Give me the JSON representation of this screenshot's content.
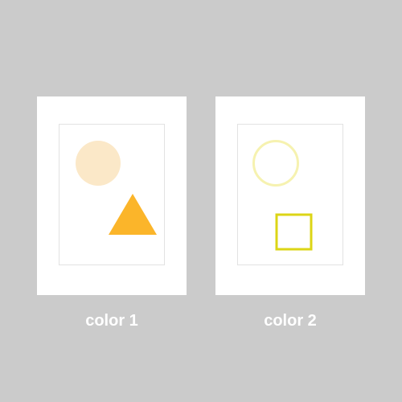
{
  "panels": [
    {
      "label": "color 1",
      "shapes": [
        {
          "kind": "circle",
          "style": "filled",
          "color": "#fbe8c8"
        },
        {
          "kind": "triangle",
          "style": "filled",
          "color": "#fbb52a"
        }
      ]
    },
    {
      "label": "color 2",
      "shapes": [
        {
          "kind": "circle",
          "style": "outline",
          "color": "#f6f2b0"
        },
        {
          "kind": "square",
          "style": "outline",
          "color": "#dcd516"
        }
      ]
    }
  ]
}
